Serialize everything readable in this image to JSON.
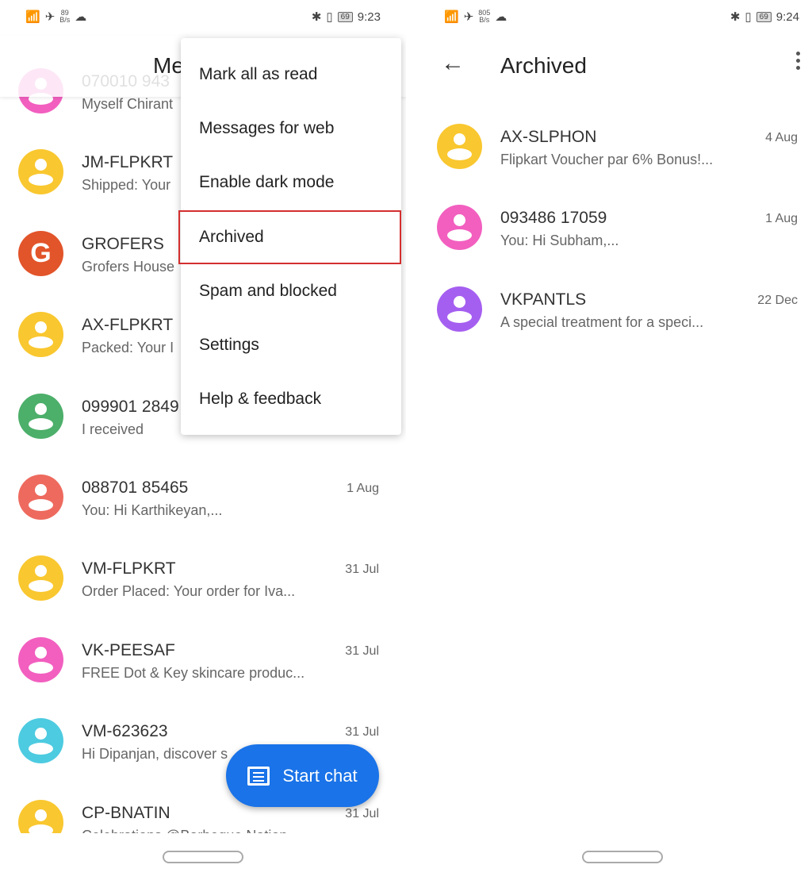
{
  "left": {
    "status": {
      "speed": "89",
      "speed_unit": "B/s",
      "battery": "69",
      "time": "9:23"
    },
    "header": {
      "title": "Me"
    },
    "conversations": [
      {
        "name": "070010 943",
        "preview": "Myself Chirant",
        "color": "#f25fbf",
        "date": ""
      },
      {
        "name": "JM-FLPKRT",
        "preview": "Shipped: Your",
        "color": "#f9c72f",
        "date": ""
      },
      {
        "name": "GROFERS",
        "preview": "Grofers House",
        "color": "#e2542a",
        "logo": "G",
        "date": ""
      },
      {
        "name": "AX-FLPKRT",
        "preview": "Packed: Your I",
        "color": "#f9c72f",
        "date": ""
      },
      {
        "name": "099901 2849",
        "preview": "I received",
        "color": "#4caf6a",
        "date": ""
      },
      {
        "name": "088701 85465",
        "preview": "You: Hi Karthikeyan,...",
        "color": "#ee6a5e",
        "date": "1 Aug"
      },
      {
        "name": "VM-FLPKRT",
        "preview": "Order Placed: Your order for Iva...",
        "color": "#f9c72f",
        "date": "31 Jul"
      },
      {
        "name": "VK-PEESAF",
        "preview": "FREE Dot & Key skincare produc...",
        "color": "#f25fbf",
        "date": "31 Jul"
      },
      {
        "name": "VM-623623",
        "preview": "Hi Dipanjan, discover s",
        "color": "#4dcbe0",
        "date": "31 Jul"
      },
      {
        "name": "CP-BNATIN",
        "preview": "Celebrations @Barbeque Nation...",
        "color": "#f9c72f",
        "date": "31 Jul"
      }
    ],
    "menu": [
      "Mark all as read",
      "Messages for web",
      "Enable dark mode",
      "Archived",
      "Spam and blocked",
      "Settings",
      "Help & feedback"
    ],
    "menu_selected": "Archived",
    "fab": {
      "label": "Start chat",
      "icon": "message-icon",
      "color": "#1a73e8"
    }
  },
  "right": {
    "status": {
      "speed": "805",
      "speed_unit": "B/s",
      "battery": "69",
      "time": "9:24"
    },
    "header": {
      "title": "Archived"
    },
    "conversations": [
      {
        "name": "AX-SLPHON",
        "preview": "Flipkart Voucher par 6% Bonus!...",
        "color": "#f9c72f",
        "date": "4 Aug"
      },
      {
        "name": "093486 17059",
        "preview": "You: Hi Subham,...",
        "color": "#f25fbf",
        "date": "1 Aug"
      },
      {
        "name": "VKPANTLS",
        "preview": "A special treatment for a speci...",
        "color": "#a55ff0",
        "date": "22 Dec"
      }
    ]
  }
}
